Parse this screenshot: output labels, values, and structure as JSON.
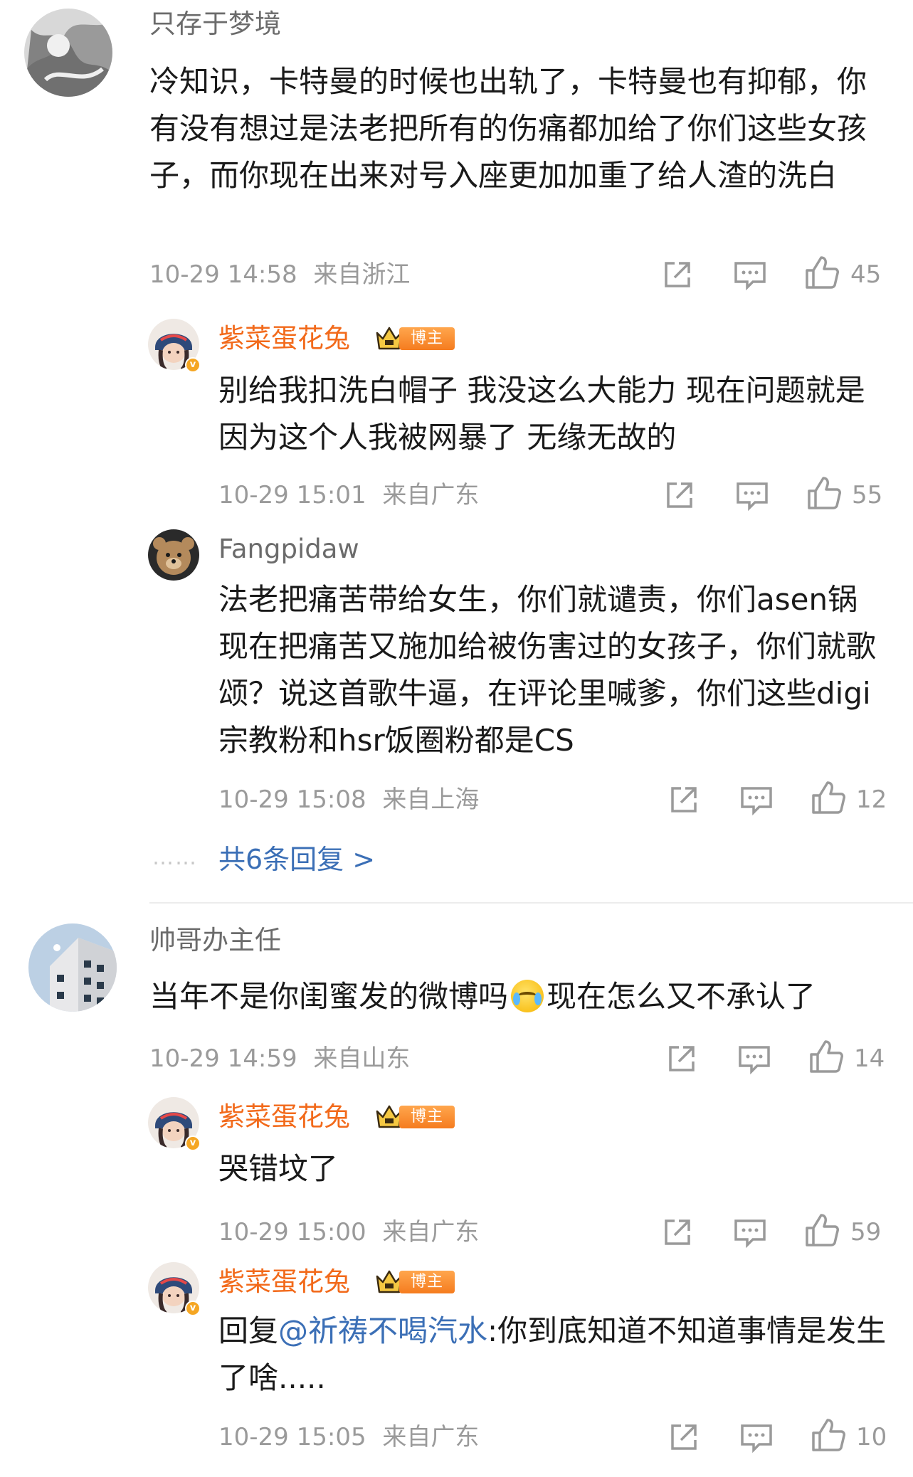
{
  "comments": [
    {
      "user": "只存于梦境",
      "text": "冷知识，卡特曼的时候也出轨了，卡特曼也有抑郁，你有没有想过是法老把所有的伤痛都加给了你们这些女孩子，而你现在出来对号入座更加加重了给人渣的洗白",
      "time": "10-29 14:58",
      "location": "来自浙江",
      "likes": "45",
      "replies": [
        {
          "user": "紫菜蛋花兔",
          "badge": "博主",
          "text": "别给我扣洗白帽子 我没这么大能力 现在问题就是因为这个人我被网暴了 无缘无故的",
          "time": "10-29 15:01",
          "location": "来自广东",
          "likes": "55"
        },
        {
          "user": "Fangpidaw",
          "text": "法老把痛苦带给女生，你们就谴责，你们asen锅现在把痛苦又施加给被伤害过的女孩子，你们就歌颂？说这首歌牛逼，在评论里喊爹，你们这些digi宗教粉和hsr饭圈粉都是CS",
          "time": "10-29 15:08",
          "location": "来自上海",
          "likes": "12"
        }
      ],
      "more": "共6条回复 >",
      "more_dots": "……"
    },
    {
      "user": "帅哥办主任",
      "text_before": "当年不是你闺蜜发的微博吗",
      "text_after": "现在怎么又不承认了",
      "emoji": "cry-laugh-emoji",
      "time": "10-29 14:59",
      "location": "来自山东",
      "likes": "14",
      "replies": [
        {
          "user": "紫菜蛋花兔",
          "badge": "博主",
          "text": "哭错坟了",
          "time": "10-29 15:00",
          "location": "来自广东",
          "likes": "59"
        },
        {
          "user": "紫菜蛋花兔",
          "badge": "博主",
          "reply_prefix": "回复",
          "mention": "@祈祷不喝汽水",
          "text": ":你到底知道不知道事情是发生了啥.....",
          "time": "10-29 15:05",
          "location": "来自广东",
          "likes": "10"
        }
      ]
    }
  ],
  "colors": {
    "author_name": "#f26a1b",
    "link": "#3b6fb6",
    "meta": "#9a9a9a"
  }
}
